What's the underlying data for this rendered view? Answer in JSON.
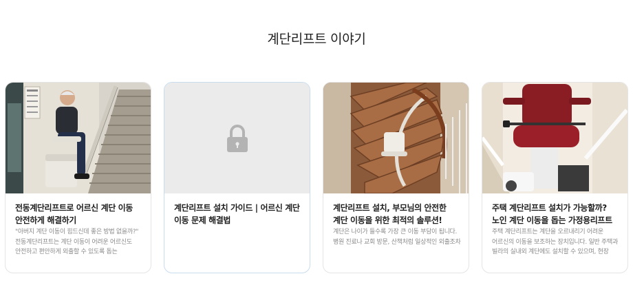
{
  "section": {
    "title": "계단리프트 이야기"
  },
  "cards": [
    {
      "title": "전동계단리프트로 어르신 계단 이동 안전하게 해결하기",
      "description": "\"아버지 계단 이동이 힘드신데 좋은 방법 없을까?\" 전동계단리프트는 계단 이동이 어려운 어르신도 안전하고 편안하게 외출할 수 있도록 돕는",
      "image": "photo-elderly-man-on-stair-lift"
    },
    {
      "title": "계단리프트 설치 가이드 | 어르신 계단 이동 문제 해결법",
      "description": "",
      "image": "lock-icon"
    },
    {
      "title": "계단리프트 설치, 부모님의 안전한 계단 이동을 위한 최적의 솔루션!",
      "description": "계단은 나이가 들수록 가장 큰 이동 부담이 됩니다. 병원 진료나 교회 방문, 산책처럼 일상적인 외출조차",
      "image": "photo-curved-staircase-with-lift"
    },
    {
      "title": "주택 계단리프트 설치가 가능할까? 노인 계단 이동을 돕는 가정용리프트",
      "description": "주택 계단리프트는 계단을 오르내리기 어려운 어르신의 이동을 보조하는 장치입니다. 일반 주택과 빌라의 실내외 계단에도 설치할 수 있으며, 현장 측정을 거쳐 계단 구조와",
      "image": "photo-red-seat-stair-lift"
    }
  ]
}
